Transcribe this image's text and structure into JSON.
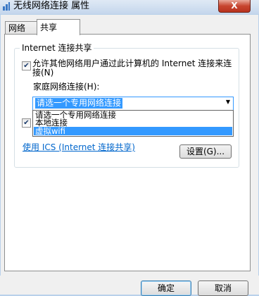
{
  "window": {
    "title": "无线网络连接 属性",
    "close_label": "X"
  },
  "tabs": [
    {
      "label": "网络",
      "selected": false
    },
    {
      "label": "共享",
      "selected": true
    }
  ],
  "sharing": {
    "group_title": "Internet 连接共享",
    "allow_checkbox": {
      "checked": true,
      "label": "允许其他网络用户通过此计算机的 Internet 连接来连接(N)"
    },
    "second_checkbox": {
      "checked": true
    },
    "home_network_label": "家庭网络连接(H):",
    "combo": {
      "selected": "请选一个专用网络连接",
      "options": [
        "请选一个专用网络连接",
        "本地连接",
        "虚拟wifi"
      ],
      "highlighted_index": 2
    },
    "ics_link": "使用 ICS (Internet 连接共享)",
    "settings_button": "设置(G)..."
  },
  "buttons": {
    "ok": "确定",
    "cancel": "取消"
  },
  "colors": {
    "selection": "#3399ff",
    "close_button": "#c7452f",
    "link": "#0066cc"
  }
}
